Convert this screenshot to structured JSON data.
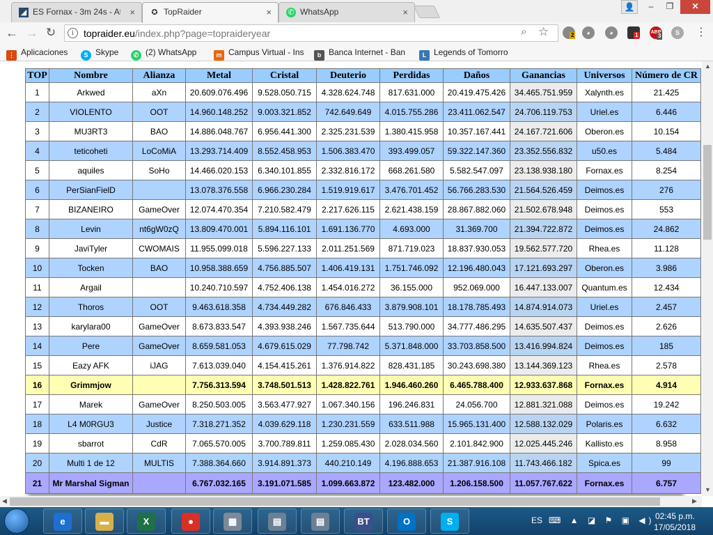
{
  "browser": {
    "tabs": [
      {
        "label": "ES Fornax - 3m 24s - Ataq",
        "icon": "ogame-icon"
      },
      {
        "label": "TopRaider",
        "icon": "topraider-icon"
      },
      {
        "label": "WhatsApp",
        "icon": "whatsapp-icon"
      }
    ],
    "tab_close": "×",
    "url_host": "topraider.eu",
    "url_path": "/index.php?page=topraideryear",
    "user_icon": "user-icon",
    "ext_badges": [
      "2",
      "1",
      "3"
    ]
  },
  "bookmarks": [
    {
      "label": "Aplicaciones",
      "icon": "apps-grid-icon"
    },
    {
      "label": "Skype",
      "icon": "skype-icon"
    },
    {
      "label": "(2) WhatsApp",
      "icon": "whatsapp-icon"
    },
    {
      "label": "Campus Virtual - Inst",
      "icon": "campus-icon"
    },
    {
      "label": "Banca Internet - Ban",
      "icon": "bank-icon"
    },
    {
      "label": "Legends of Tomorro",
      "icon": "legends-icon"
    }
  ],
  "table": {
    "headers": [
      "TOP",
      "Nombre",
      "Alianza",
      "Metal",
      "Cristal",
      "Deuterio",
      "Perdidas",
      "Daños",
      "Ganancias",
      "Universos",
      "Número de CR"
    ],
    "rows": [
      [
        "1",
        "Arkwed",
        "aXn",
        "20.609.076.496",
        "9.528.050.715",
        "4.328.624.748",
        "817.631.000",
        "20.419.475.426",
        "34.465.751.959",
        "Xalynth.es",
        "21.425"
      ],
      [
        "2",
        "VIOLENTO",
        "OOT",
        "14.960.148.252",
        "9.003.321.852",
        "742.649.649",
        "4.015.755.286",
        "23.411.062.547",
        "24.706.119.753",
        "Uriel.es",
        "6.446"
      ],
      [
        "3",
        "MU3RT3",
        "BAO",
        "14.886.048.767",
        "6.956.441.300",
        "2.325.231.539",
        "1.380.415.958",
        "10.357.167.441",
        "24.167.721.606",
        "Oberon.es",
        "10.154"
      ],
      [
        "4",
        "teticoheti",
        "LoCoMiA",
        "13.293.714.409",
        "8.552.458.953",
        "1.506.383.470",
        "393.499.057",
        "59.322.147.360",
        "23.352.556.832",
        "u50.es",
        "5.484"
      ],
      [
        "5",
        "aquiles",
        "SoHo",
        "14.466.020.153",
        "6.340.101.855",
        "2.332.816.172",
        "668.261.580",
        "5.582.547.097",
        "23.138.938.180",
        "Fornax.es",
        "8.254"
      ],
      [
        "6",
        "PerSianFielD",
        "",
        "13.078.376.558",
        "6.966.230.284",
        "1.519.919.617",
        "3.476.701.452",
        "56.766.283.530",
        "21.564.526.459",
        "Deimos.es",
        "276"
      ],
      [
        "7",
        "BIZANEIRO",
        "GameOver",
        "12.074.470.354",
        "7.210.582.479",
        "2.217.626.115",
        "2.621.438.159",
        "28.867.882.060",
        "21.502.678.948",
        "Deimos.es",
        "553"
      ],
      [
        "8",
        "Levin",
        "nt6gW0zQ",
        "13.809.470.001",
        "5.894.116.101",
        "1.691.136.770",
        "4.693.000",
        "31.369.700",
        "21.394.722.872",
        "Deimos.es",
        "24.862"
      ],
      [
        "9",
        "JaviTyler",
        "CWOMAIS",
        "11.955.099.018",
        "5.596.227.133",
        "2.011.251.569",
        "871.719.023",
        "18.837.930.053",
        "19.562.577.720",
        "Rhea.es",
        "11.128"
      ],
      [
        "10",
        "Tocken",
        "BAO",
        "10.958.388.659",
        "4.756.885.507",
        "1.406.419.131",
        "1.751.746.092",
        "12.196.480.043",
        "17.121.693.297",
        "Oberon.es",
        "3.986"
      ],
      [
        "11",
        "Argail",
        "",
        "10.240.710.597",
        "4.752.406.138",
        "1.454.016.272",
        "36.155.000",
        "952.069.000",
        "16.447.133.007",
        "Quantum.es",
        "12.434"
      ],
      [
        "12",
        "Thoros",
        "OOT",
        "9.463.618.358",
        "4.734.449.282",
        "676.846.433",
        "3.879.908.101",
        "18.178.785.493",
        "14.874.914.073",
        "Uriel.es",
        "2.457"
      ],
      [
        "13",
        "karylara00",
        "GameOver",
        "8.673.833.547",
        "4.393.938.246",
        "1.567.735.644",
        "513.790.000",
        "34.777.486.295",
        "14.635.507.437",
        "Deimos.es",
        "2.626"
      ],
      [
        "14",
        "Pere",
        "GameOver",
        "8.659.581.053",
        "4.679.615.029",
        "77.798.742",
        "5.371.848.000",
        "33.703.858.500",
        "13.416.994.824",
        "Deimos.es",
        "185"
      ],
      [
        "15",
        "Eazy AFK",
        "iJAG",
        "7.613.039.040",
        "4.154.415.261",
        "1.376.914.822",
        "828.431.185",
        "30.243.698.380",
        "13.144.369.123",
        "Rhea.es",
        "2.578"
      ],
      [
        "16",
        "Grimmjow",
        "",
        "7.756.313.594",
        "3.748.501.513",
        "1.428.822.761",
        "1.946.460.260",
        "6.465.788.400",
        "12.933.637.868",
        "Fornax.es",
        "4.914"
      ],
      [
        "17",
        "Marek",
        "GameOver",
        "8.250.503.005",
        "3.563.477.927",
        "1.067.340.156",
        "196.246.831",
        "24.056.700",
        "12.881.321.088",
        "Deimos.es",
        "19.242"
      ],
      [
        "18",
        "L4 M0RGU3",
        "Justice",
        "7.318.271.352",
        "4.039.629.118",
        "1.230.231.559",
        "633.511.988",
        "15.965.131.400",
        "12.588.132.029",
        "Polaris.es",
        "6.632"
      ],
      [
        "19",
        "sbarrot",
        "CdR",
        "7.065.570.005",
        "3.700.789.811",
        "1.259.085.430",
        "2.028.034.560",
        "2.101.842.900",
        "12.025.445.246",
        "Kallisto.es",
        "8.958"
      ],
      [
        "20",
        "Multi 1 de 12",
        "MULTIS",
        "7.388.364.660",
        "3.914.891.373",
        "440.210.149",
        "4.196.888.653",
        "21.387.916.108",
        "11.743.466.182",
        "Spica.es",
        "99"
      ],
      [
        "21",
        "Mr Marshal Sigman",
        "",
        "6.767.032.165",
        "3.191.071.585",
        "1.099.663.872",
        "123.482.000",
        "1.206.158.500",
        "11.057.767.622",
        "Fornax.es",
        "6.757"
      ]
    ],
    "highlight_row": 16,
    "own_row": 21
  },
  "taskbar": {
    "apps": [
      {
        "name": "ie-icon",
        "glyph": "e"
      },
      {
        "name": "explorer-icon",
        "glyph": "▬"
      },
      {
        "name": "excel-icon",
        "glyph": "X"
      },
      {
        "name": "chrome-icon",
        "glyph": "●"
      },
      {
        "name": "calculator-icon",
        "glyph": "▦"
      },
      {
        "name": "document-icon",
        "glyph": "▤"
      },
      {
        "name": "document-icon-2",
        "glyph": "▤"
      },
      {
        "name": "bittorrent-icon",
        "glyph": "BT"
      },
      {
        "name": "outlook-icon",
        "glyph": "O"
      },
      {
        "name": "skype-icon",
        "glyph": "S"
      }
    ],
    "lang": "ES",
    "time": "02:45 p.m.",
    "date": "17/05/2018"
  },
  "colors": {
    "header": "#99ccff",
    "row_alt": "#afd3ff",
    "highlight": "#ffffb3",
    "own": "#a9a7ff"
  }
}
